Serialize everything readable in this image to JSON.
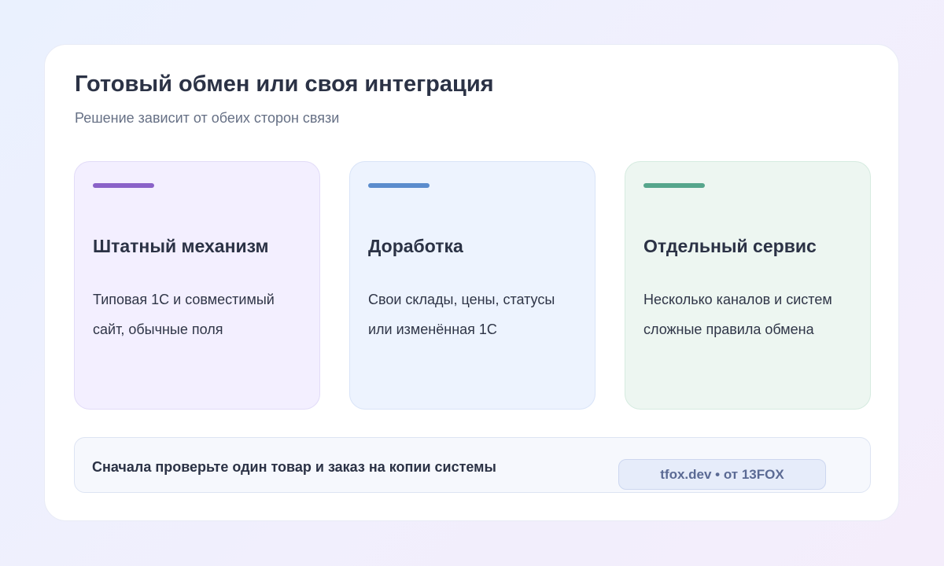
{
  "header": {
    "title": "Готовый обмен или своя интеграция",
    "subtitle": "Решение зависит от обеих сторон связи"
  },
  "cards": [
    {
      "title": "Штатный механизм",
      "lines": [
        "Типовая 1С и совместимый",
        "сайт, обычные поля"
      ],
      "accent_color": "#8a62c8"
    },
    {
      "title": "Доработка",
      "lines": [
        "Свои склады, цены, статусы",
        "или изменённая 1С"
      ],
      "accent_color": "#5b8ccd"
    },
    {
      "title": "Отдельный сервис",
      "lines": [
        "Несколько каналов и систем",
        "сложные правила обмена"
      ],
      "accent_color": "#56a68c"
    }
  ],
  "footer": {
    "note": "Сначала проверьте один товар и заказ на копии системы",
    "brand": "tfox.dev • от 13FOX"
  }
}
